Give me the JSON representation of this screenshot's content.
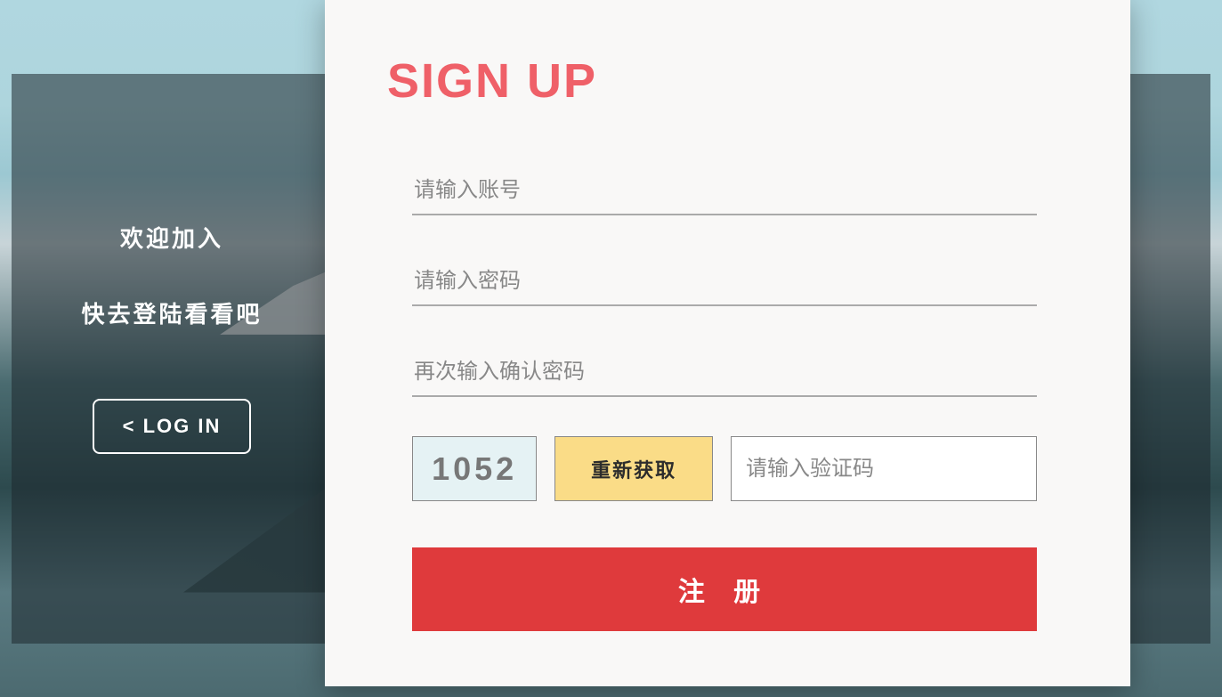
{
  "left": {
    "welcome_line1": "欢迎加入",
    "welcome_line2": "快去登陆看看吧",
    "login_button": "<  LOG IN"
  },
  "signup": {
    "title": "SIGN UP",
    "account_placeholder": "请输入账号",
    "password_placeholder": "请输入密码",
    "confirm_password_placeholder": "再次输入确认密码",
    "captcha_value": "1052",
    "refresh_label": "重新获取",
    "captcha_placeholder": "请输入验证码",
    "submit_label": "注 册"
  }
}
